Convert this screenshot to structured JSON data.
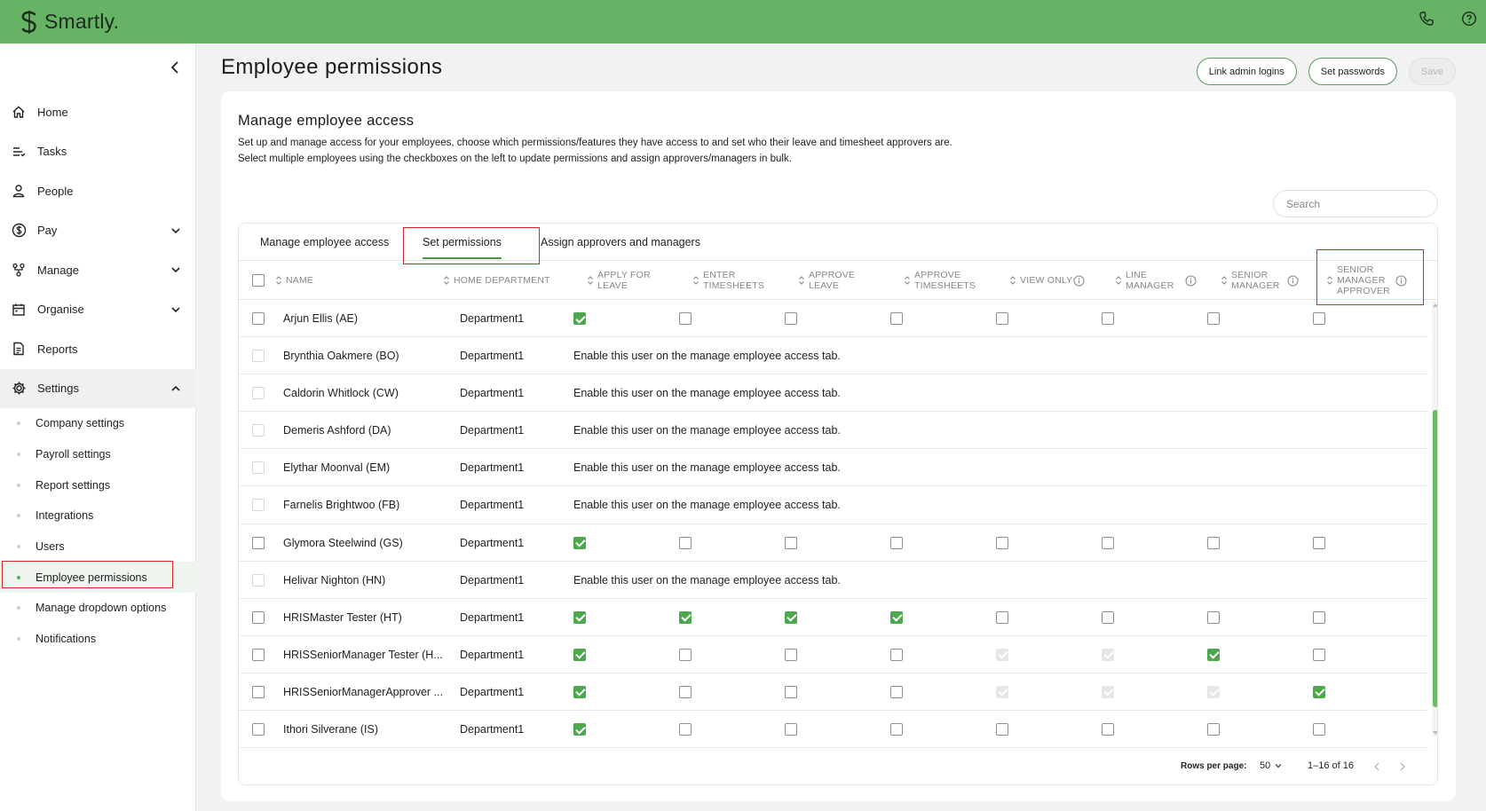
{
  "app": {
    "logo_text": "Smartly.",
    "brand_color": "#66b366",
    "accent_color": "#4da84d"
  },
  "topbar": {
    "icons": [
      "phone-icon",
      "help-icon"
    ]
  },
  "sidebar": {
    "items": [
      {
        "label": "Home",
        "icon": "home-icon"
      },
      {
        "label": "Tasks",
        "icon": "tasks-icon"
      },
      {
        "label": "People",
        "icon": "person-icon"
      },
      {
        "label": "Pay",
        "icon": "dollar-icon",
        "expandable": true
      },
      {
        "label": "Manage",
        "icon": "manage-icon",
        "expandable": true
      },
      {
        "label": "Organise",
        "icon": "calendar-icon",
        "expandable": true
      },
      {
        "label": "Reports",
        "icon": "report-icon"
      },
      {
        "label": "Settings",
        "icon": "gear-icon",
        "expanded": true
      }
    ],
    "settings_sub": [
      {
        "label": "Company settings"
      },
      {
        "label": "Payroll settings"
      },
      {
        "label": "Report settings"
      },
      {
        "label": "Integrations"
      },
      {
        "label": "Users"
      },
      {
        "label": "Employee permissions",
        "active": true
      },
      {
        "label": "Manage dropdown options"
      },
      {
        "label": "Notifications"
      }
    ]
  },
  "header": {
    "title": "Employee permissions",
    "link_admin_label": "Link admin logins",
    "set_passwords_label": "Set passwords",
    "save_label": "Save"
  },
  "card": {
    "title": "Manage employee access",
    "desc_line1": "Set up and manage access for your employees, choose which permissions/features they have access to and set who their leave and timesheet approvers are.",
    "desc_line2": "Select multiple employees using the checkboxes on the left to update permissions and assign approvers/managers in bulk.",
    "search_placeholder": "Search"
  },
  "tabs": [
    {
      "label": "Manage employee access"
    },
    {
      "label": "Set permissions",
      "active": true
    },
    {
      "label": "Assign approvers and managers"
    }
  ],
  "columns": {
    "name": "NAME",
    "dept": "HOME DEPARTMENT",
    "apply_leave_1": "APPLY FOR",
    "apply_leave_2": "LEAVE",
    "enter_ts_1": "ENTER",
    "enter_ts_2": "TIMESHEETS",
    "approve_leave_1": "APPROVE",
    "approve_leave_2": "LEAVE",
    "approve_ts_1": "APPROVE",
    "approve_ts_2": "TIMESHEETS",
    "view_only": "VIEW ONLY",
    "line_mgr_1": "LINE",
    "line_mgr_2": "MANAGER",
    "senior_mgr_1": "SENIOR",
    "senior_mgr_2": "MANAGER",
    "sma_1": "SENIOR",
    "sma_2": "MANAGER",
    "sma_3": "APPROVER"
  },
  "enable_message": "Enable this user on the manage employee access tab.",
  "rows": [
    {
      "name": "Arjun Ellis (AE)",
      "dept": "Department1",
      "enabled": true,
      "perms": [
        "c",
        "u",
        "u",
        "u",
        "u",
        "u",
        "u",
        "u"
      ]
    },
    {
      "name": "Brynthia Oakmere (BO)",
      "dept": "Department1",
      "enabled": false
    },
    {
      "name": "Caldorin Whitlock (CW)",
      "dept": "Department1",
      "enabled": false
    },
    {
      "name": "Demeris Ashford (DA)",
      "dept": "Department1",
      "enabled": false
    },
    {
      "name": "Elythar Moonval (EM)",
      "dept": "Department1",
      "enabled": false
    },
    {
      "name": "Farnelis Brightwoo (FB)",
      "dept": "Department1",
      "enabled": false
    },
    {
      "name": "Glymora Steelwind (GS)",
      "dept": "Department1",
      "enabled": true,
      "perms": [
        "c",
        "u",
        "u",
        "u",
        "u",
        "u",
        "u",
        "u"
      ]
    },
    {
      "name": "Helivar Nighton (HN)",
      "dept": "Department1",
      "enabled": false
    },
    {
      "name": "HRISMaster Tester (HT)",
      "dept": "Department1",
      "enabled": true,
      "perms": [
        "c",
        "c",
        "c",
        "c",
        "u",
        "u",
        "u",
        "u"
      ]
    },
    {
      "name": "HRISSeniorManager Tester (H...",
      "dept": "Department1",
      "enabled": true,
      "perms": [
        "c",
        "u",
        "u",
        "u",
        "d",
        "d",
        "c",
        "u"
      ]
    },
    {
      "name": "HRISSeniorManagerApprover ...",
      "dept": "Department1",
      "enabled": true,
      "perms": [
        "c",
        "u",
        "u",
        "u",
        "d",
        "d",
        "d",
        "c"
      ]
    },
    {
      "name": "Ithori Silverane (IS)",
      "dept": "Department1",
      "enabled": true,
      "perms": [
        "c",
        "u",
        "u",
        "u",
        "u",
        "u",
        "u",
        "u"
      ]
    }
  ],
  "footer": {
    "rows_per_page_label": "Rows per page:",
    "rows_per_page_value": "50",
    "range": "1–16 of 16"
  }
}
